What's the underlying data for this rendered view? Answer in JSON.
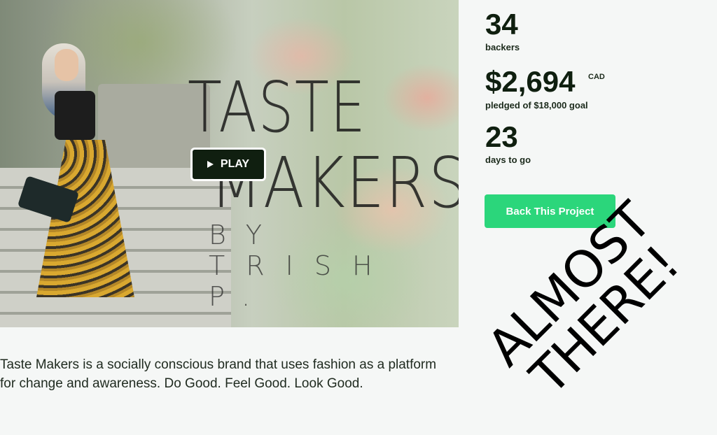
{
  "video": {
    "brand_line1": "TASTE",
    "brand_line2": "MAKERS",
    "brand_line3": "BY TRISH P.",
    "play_label": "PLAY"
  },
  "stats": {
    "backers_count": "34",
    "backers_label": "backers",
    "pledged_amount": "$2,694",
    "pledged_currency": "CAD",
    "pledged_label": "pledged of $18,000 goal",
    "days_count": "23",
    "days_label": "days to go"
  },
  "cta": {
    "back_label": "Back This Project"
  },
  "description": "Taste Makers is a socially conscious brand that uses fashion as a platform for change and awareness. Do Good. Feel Good. Look Good.",
  "overlay": {
    "line1": "ALMOST",
    "line2": "THERE!"
  },
  "colors": {
    "accent_green": "#2bd67b",
    "dark_text": "#0f1f0f",
    "play_bg": "#101f10"
  }
}
